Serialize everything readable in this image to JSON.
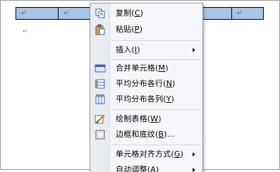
{
  "document": {
    "cell_marks": [
      "↵",
      "↵",
      "↵"
    ],
    "paragraph_mark": "↵"
  },
  "context_menu": {
    "items": [
      {
        "name": "copy",
        "text": "复制(",
        "key": "C",
        "end": ")",
        "icon": "copy-icon",
        "submenu": false
      },
      {
        "name": "paste",
        "text": "粘贴(",
        "key": "P",
        "end": ")",
        "icon": "paste-icon",
        "submenu": false
      },
      {
        "name": "insert",
        "text": "插入(",
        "key": "I",
        "end": ")",
        "icon": null,
        "submenu": true
      },
      {
        "name": "merge-cells",
        "text": "合并单元格(",
        "key": "M",
        "end": ")",
        "icon": "merge-cells-icon",
        "submenu": false
      },
      {
        "name": "distribute-rows",
        "text": "平均分布各行(",
        "key": "N",
        "end": ")",
        "icon": "distribute-rows-icon",
        "submenu": false
      },
      {
        "name": "distribute-columns",
        "text": "平均分布各列(",
        "key": "Y",
        "end": ")",
        "icon": "distribute-columns-icon",
        "submenu": false
      },
      {
        "name": "draw-table",
        "text": "绘制表格(",
        "key": "W",
        "end": ")",
        "icon": "draw-table-icon",
        "submenu": false
      },
      {
        "name": "borders-shading",
        "text": "边框和底纹(",
        "key": "B",
        "end": ")...",
        "icon": "borders-icon",
        "submenu": false
      },
      {
        "name": "cell-alignment",
        "text": "单元格对齐方式(",
        "key": "G",
        "end": ")",
        "icon": null,
        "submenu": true
      },
      {
        "name": "autofit",
        "text": "自动调整(",
        "key": "A",
        "end": ")",
        "icon": null,
        "submenu": true
      }
    ]
  }
}
